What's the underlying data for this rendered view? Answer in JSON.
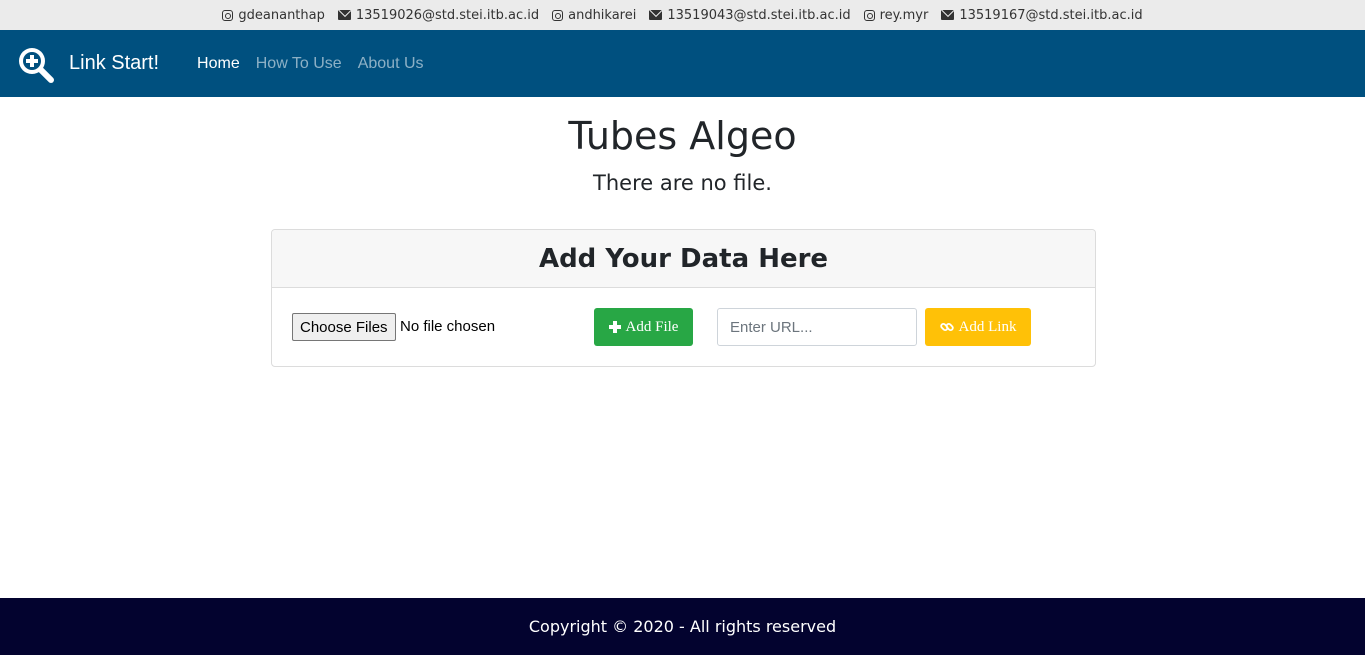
{
  "contacts": [
    {
      "type": "instagram",
      "icon": "instagram-icon",
      "text": "gdeananthap"
    },
    {
      "type": "email",
      "icon": "envelope-icon",
      "text": "13519026@std.stei.itb.ac.id"
    },
    {
      "type": "instagram",
      "icon": "instagram-icon",
      "text": "andhikarei"
    },
    {
      "type": "email",
      "icon": "envelope-icon",
      "text": "13519043@std.stei.itb.ac.id"
    },
    {
      "type": "instagram",
      "icon": "instagram-icon",
      "text": "rey.myr"
    },
    {
      "type": "email",
      "icon": "envelope-icon",
      "text": "13519167@std.stei.itb.ac.id"
    }
  ],
  "navbar": {
    "brand": "Link Start!",
    "brand_icon": "search-plus-icon",
    "links": [
      "Home",
      "How To Use",
      "About Us"
    ],
    "active": "Home",
    "background": "#00507f"
  },
  "main": {
    "title": "Tubes Algeo",
    "subtitle": "There are no file."
  },
  "card": {
    "header": "Add Your Data Here",
    "file_button": "Choose Files",
    "file_status": "No file chosen",
    "add_file_label": "Add File",
    "add_file_color": "#28a745",
    "url_placeholder": "Enter URL...",
    "add_link_label": "Add Link",
    "add_link_color": "#ffc107"
  },
  "footer": {
    "text": "Copyright © 2020 - All rights reserved",
    "background": "#03032f"
  }
}
